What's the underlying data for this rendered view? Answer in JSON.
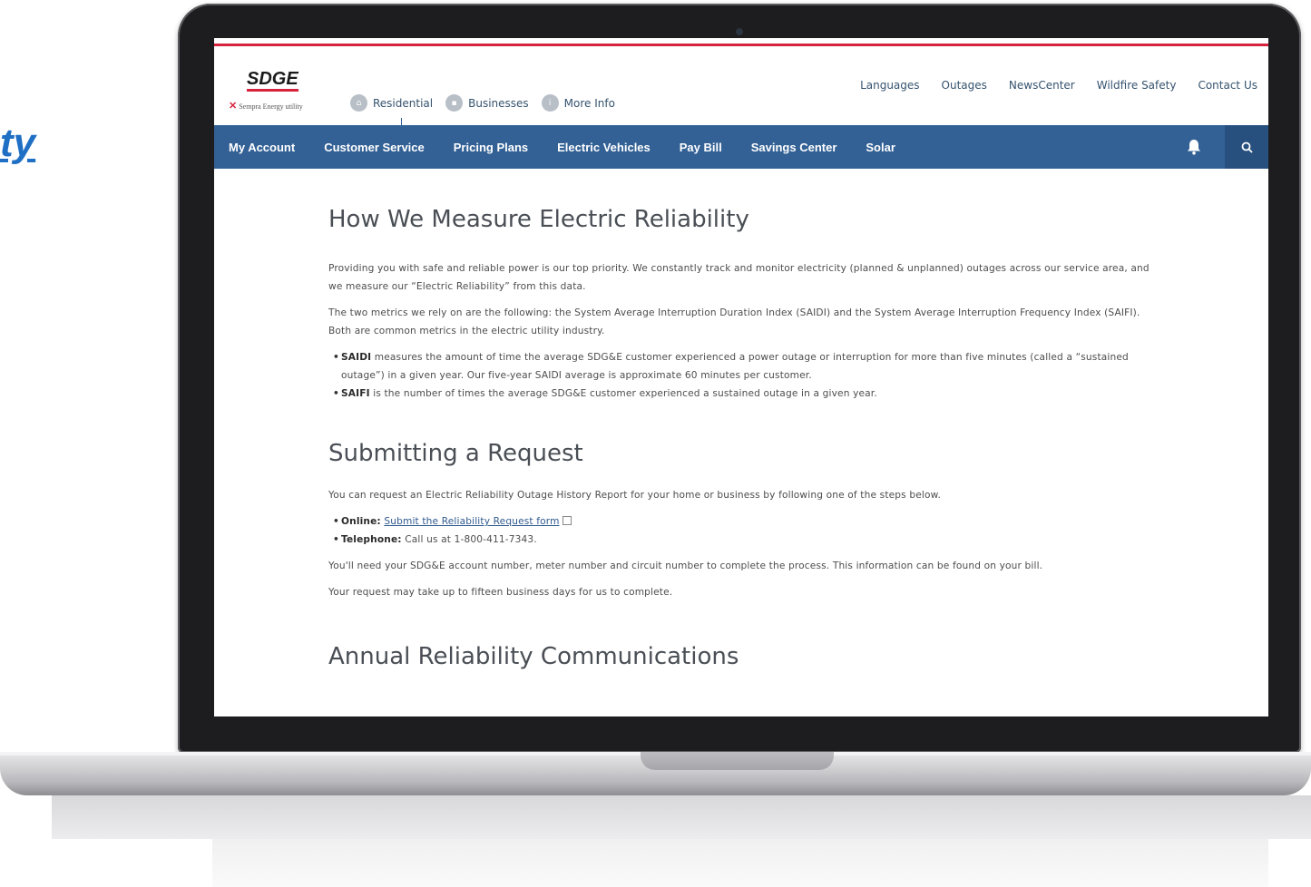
{
  "side_text": "ty",
  "logo": {
    "name": "SDGE",
    "subtitle": "Sempra Energy utility"
  },
  "segment_tabs": [
    {
      "label": "Residential",
      "active": true
    },
    {
      "label": "Businesses",
      "active": false
    },
    {
      "label": "More Info",
      "active": false
    }
  ],
  "top_links": [
    "Languages",
    "Outages",
    "NewsCenter",
    "Wildfire Safety",
    "Contact Us"
  ],
  "nav": [
    "My Account",
    "Customer Service",
    "Pricing Plans",
    "Electric Vehicles",
    "Pay Bill",
    "Savings Center",
    "Solar"
  ],
  "colors": {
    "accent_red": "#d7233d",
    "nav_blue": "#336195",
    "link_blue": "#2f5a8f"
  },
  "icons": {
    "bell": "bell-icon",
    "search": "search-icon",
    "external": "external-link-icon"
  },
  "sections": {
    "measure": {
      "title": "How We Measure Electric Reliability",
      "p1": "Providing you with safe and reliable power is our top priority. We constantly track and monitor electricity (planned & unplanned) outages across our service area, and we measure our “Electric Reliability” from this data.",
      "p2": "The two metrics we rely on are the following: the System Average Interruption Duration Index (SAIDI) and the System Average Interruption Frequency Index (SAIFI). Both are common metrics in the electric utility industry.",
      "bullets": [
        {
          "term": "SAIDI",
          "text": " measures the amount of time the average SDG&E customer experienced a power outage or interruption for more than five minutes (called a “sustained outage”) in a given year. Our five-year SAIDI average is approximate 60 minutes per customer."
        },
        {
          "term": "SAIFI",
          "text": " is the number of times the average SDG&E customer experienced a sustained outage in a given year."
        }
      ]
    },
    "request": {
      "title": "Submitting a Request",
      "p1": "You can request an Electric Reliability Outage History Report for your home or business by following one of the steps below.",
      "online_label": "Online:",
      "online_link": "Submit the Reliability Request form",
      "phone_label": "Telephone:",
      "phone_text": " Call us at 1-800-411-7343.",
      "p2": "You'll need your SDG&E account number, meter number and circuit number to complete the process. This information can be found on your bill.",
      "p3": "Your request may take up to fifteen business days for us to complete."
    },
    "annual": {
      "title": "Annual Reliability Communications"
    }
  }
}
